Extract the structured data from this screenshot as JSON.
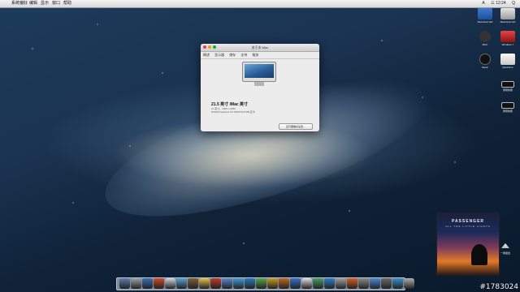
{
  "menubar": {
    "apple_glyph": "",
    "menus": [
      "系统偏好",
      "编辑",
      "显示",
      "窗口",
      "帮助"
    ],
    "status": [
      "A",
      "三 12:24",
      "Q"
    ]
  },
  "dialog": {
    "title": "关于本 Mac",
    "tabs": [
      "概述",
      "显示器",
      "储存",
      "支持",
      "服务"
    ],
    "model": "21.5 英寸 iMac 英寸",
    "spec1": "21 英寸，1920 x 1080",
    "spec2": "NVIDIA GeForce GT 640M 512 MB 显卡",
    "support_button": "显示器偏好设置…"
  },
  "desktop_icons": [
    {
      "label": "Macintosh HD"
    },
    {
      "label": "Macintosh HD"
    },
    {
      "label": "MAC"
    },
    {
      "label": "Windows 7"
    },
    {
      "label": "Music"
    },
    {
      "label": "Quicktime"
    },
    {
      "label": "屏幕快照"
    },
    {
      "label": "屏幕快照"
    }
  ],
  "album": {
    "title": "PASSENGER",
    "subtitle": "ALL THE LITTLE LIGHTS"
  },
  "eject_label": "一键退出",
  "dock_colors": [
    "#5b7fb0",
    "#9aa4ad",
    "#3a6fb8",
    "#d84a2a",
    "#d0d8e0",
    "#59a3d6",
    "#7d5e3a",
    "#e8c34a",
    "#c03a2a",
    "#5a8acb",
    "#3d9cd8",
    "#2c78c0",
    "#5aa848",
    "#c8a020",
    "#c06a1a",
    "#3a6fd0",
    "#e0e0e0",
    "#4aa060",
    "#2f80c8",
    "#a0a0a0",
    "#d86020",
    "#8a8a8a",
    "#4a8ad8",
    "#6a6a6a",
    "#3a90d0",
    "#b0b0b0"
  ],
  "watermark": "#1783024"
}
